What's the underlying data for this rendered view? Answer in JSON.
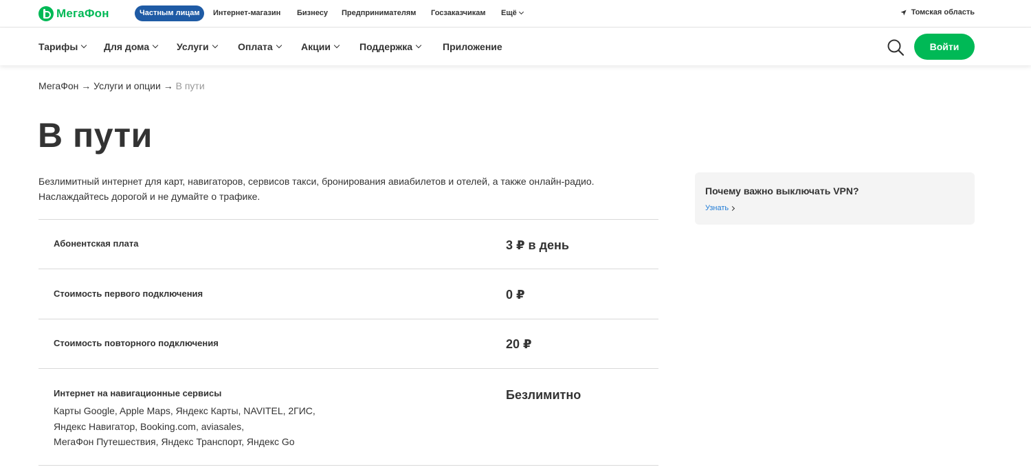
{
  "header": {
    "logo_text": "МегаФон",
    "segments": [
      "Частным лицам",
      "Интернет-магазин",
      "Бизнесу",
      "Предпринимателям",
      "Госзаказчикам",
      "Ещё"
    ],
    "region": "Томская область"
  },
  "nav": {
    "items": [
      "Тарифы",
      "Для дома",
      "Услуги",
      "Оплата",
      "Акции",
      "Поддержка",
      "Приложение"
    ],
    "login_label": "Войти"
  },
  "breadcrumb": {
    "items": [
      "МегаФон",
      "Услуги и опции",
      "В пути"
    ],
    "separator": "→"
  },
  "page": {
    "title": "В пути",
    "description_line1": "Безлимитный интернет для карт, навигаторов, сервисов такси, бронирования авиабилетов и отелей, а также онлайн-радио.",
    "description_line2": "Наслаждайтесь дорогой и не думайте о трафике."
  },
  "params": [
    {
      "label": "Абонентская плата",
      "value": "3 ₽ в день"
    },
    {
      "label": "Стоимость первого подключения",
      "value": "0 ₽"
    },
    {
      "label": "Стоимость повторного подключения",
      "value": "20 ₽"
    },
    {
      "label": "Интернет на навигационные сервисы",
      "value": "Безлимитно",
      "details": [
        "Карты Google, Apple Maps, Яндекс Карты, NAVITEL, 2ГИС,",
        "Яндекс Навигатор, Booking.com, aviasales,",
        "МегаФон Путешествия, Яндекс Транспорт, Яндекс Go"
      ]
    }
  ],
  "vpn_card": {
    "title": "Почему важно выключать VPN?",
    "link": "Узнать"
  },
  "colors": {
    "brand_green": "#00b956",
    "segment_active": "#1f5ba5",
    "link_blue": "#1f7bd6"
  }
}
